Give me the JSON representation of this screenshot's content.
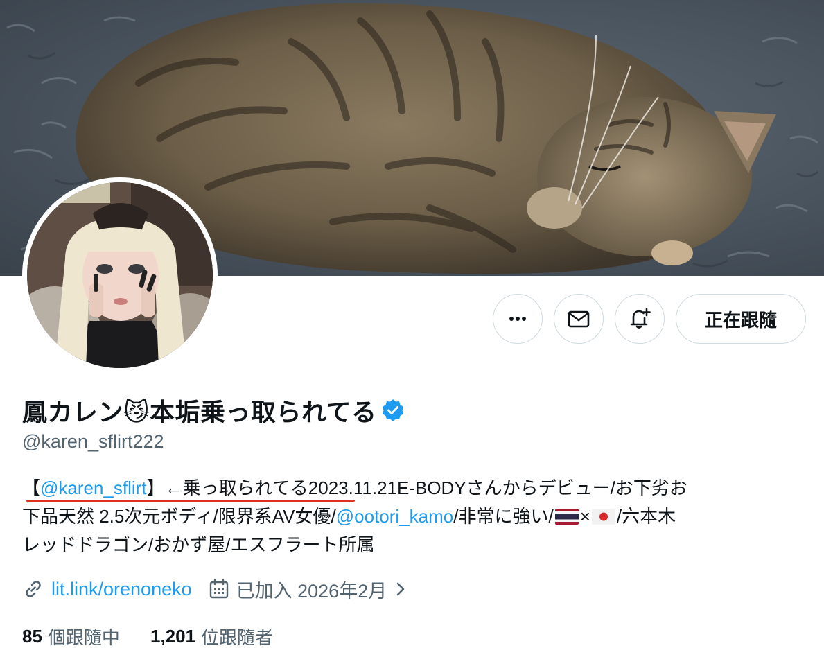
{
  "banner": {
    "alt": "sleeping tabby cat on gray fluffy rug"
  },
  "avatar": {
    "label": "profile-photo"
  },
  "actions": {
    "more_icon": "more-dots-icon",
    "message_icon": "envelope-icon",
    "notify_icon": "bell-plus-icon",
    "follow_label": "正在跟隨"
  },
  "profile": {
    "display_name": "鳳カレン😼本垢乗っ取られてる",
    "handle": "@karen_sflirt222",
    "verified_icon": "verified-badge-icon",
    "verified_color": "#1d9bf0"
  },
  "bio": {
    "l1_open": "【",
    "l1_mention": "@karen_sflirt",
    "l1_rest": "】←乗っ取られてる2023.11.21E-BODYさんからデビュー/お下劣お",
    "l2_pre": "下品天然 2.5次元ボディ/限界系AV女優/",
    "l2_mention": "@ootori_kamo",
    "l2_mid": "/非常に強い/",
    "l2_times": "×",
    "l2_post": "/六本木",
    "l3": "レッドドラゴン/おかず屋/エスフラート所属",
    "highlight_color": "#e0301e"
  },
  "meta": {
    "link_icon": "link-icon",
    "link_text": "lit.link/orenoneko",
    "calendar_icon": "calendar-icon",
    "joined_text": "已加入 2026年2月",
    "chevron_icon": "chevron-right-icon"
  },
  "stats": {
    "following_count": "85",
    "following_label": "個跟隨中",
    "followers_count": "1,201",
    "followers_label": "位跟隨者"
  },
  "colors": {
    "accent": "#1d9bf0",
    "text": "#0f1419",
    "secondary": "#536471",
    "border": "#cfd9de"
  }
}
